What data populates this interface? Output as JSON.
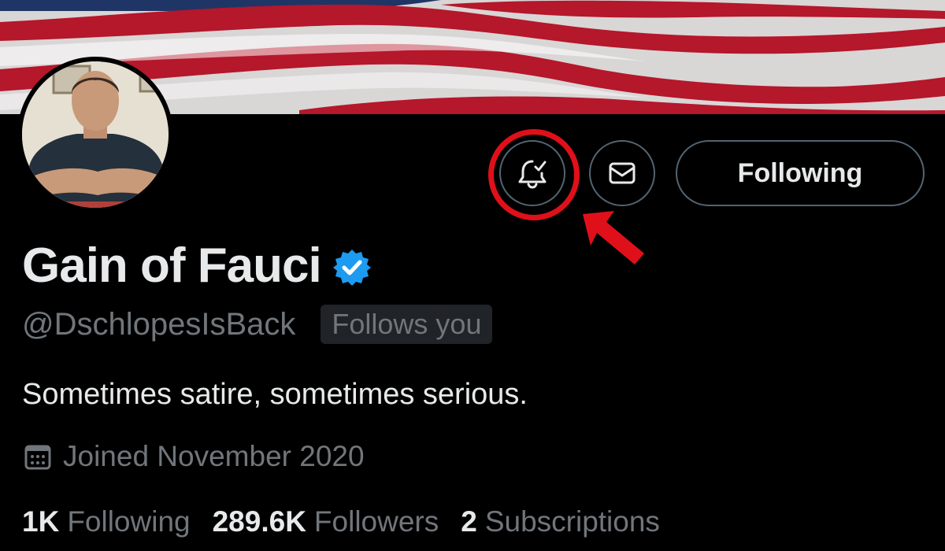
{
  "profile": {
    "display_name": "Gain of Fauci",
    "handle": "@DschlopesIsBack",
    "follows_you": "Follows you",
    "bio": "Sometimes satire, sometimes serious.",
    "joined": "Joined November 2020",
    "verified": true
  },
  "actions": {
    "notify_icon": "bell-check-icon",
    "message_icon": "envelope-icon",
    "following_label": "Following"
  },
  "stats": [
    {
      "value": "1K",
      "label": "Following"
    },
    {
      "value": "289.6K",
      "label": "Followers"
    },
    {
      "value": "2",
      "label": "Subscriptions"
    }
  ],
  "colors": {
    "background": "#000000",
    "text_primary": "#e7e9ea",
    "text_secondary": "#71767b",
    "verified_blue": "#1d9bf0",
    "highlight_red": "#e0101a",
    "button_border": "#536471"
  }
}
